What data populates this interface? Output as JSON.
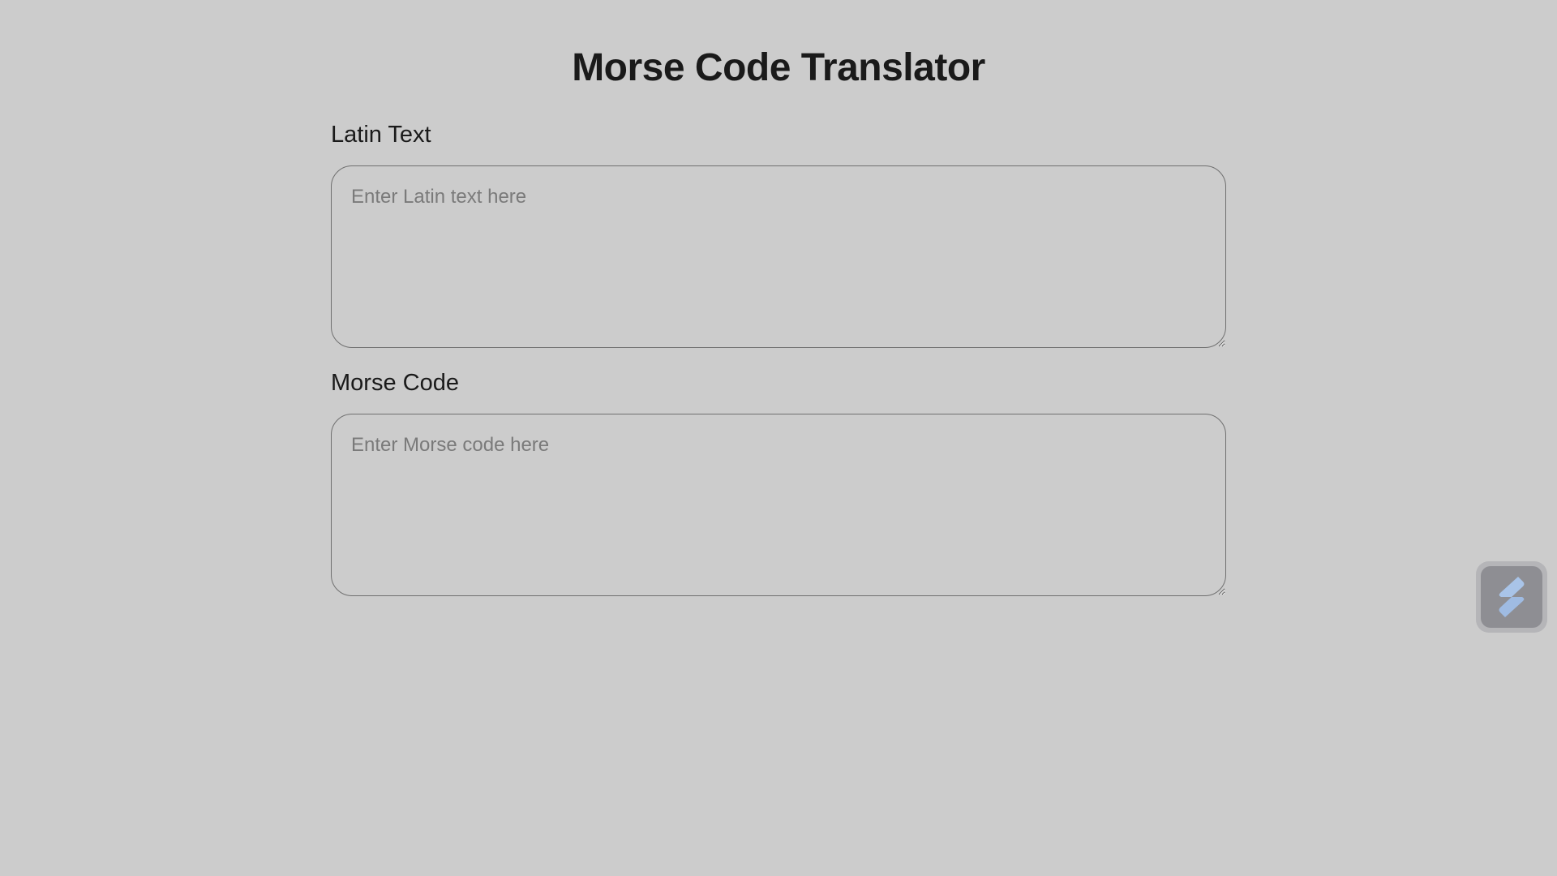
{
  "page": {
    "title": "Morse Code Translator"
  },
  "latin": {
    "label": "Latin Text",
    "value": "",
    "placeholder": "Enter Latin text here"
  },
  "morse": {
    "label": "Morse Code",
    "value": "",
    "placeholder": "Enter Morse code here"
  },
  "widget": {
    "icon": "lightning-bolt-icon",
    "accent": "#a9c4e8"
  },
  "colors": {
    "background": "#cccccc",
    "text": "#1a1a1a",
    "border": "#6f6f6f",
    "placeholder": "#7a7a7a"
  }
}
